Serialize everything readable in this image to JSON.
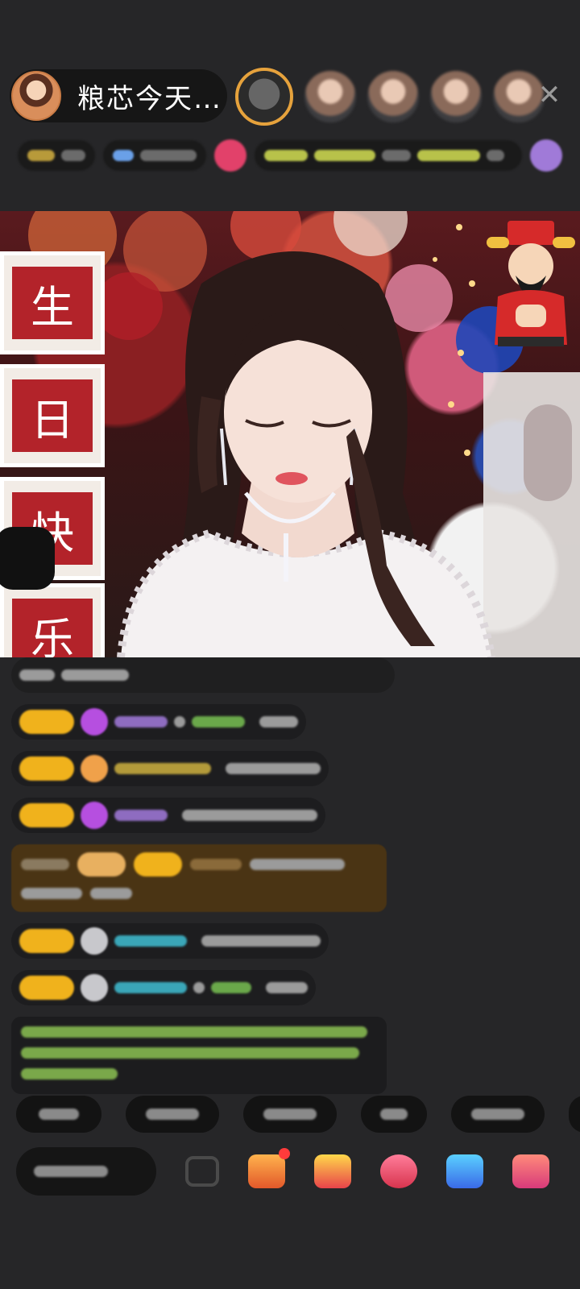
{
  "header": {
    "streamer_name": "粮芯今天…",
    "close_glyph": "✕"
  },
  "video": {
    "board_chars": [
      "生",
      "日",
      "快",
      "乐"
    ]
  },
  "colors": {
    "background": "#262628",
    "level_badge": "#f0b21c",
    "accent_pink": "#e2416a"
  }
}
